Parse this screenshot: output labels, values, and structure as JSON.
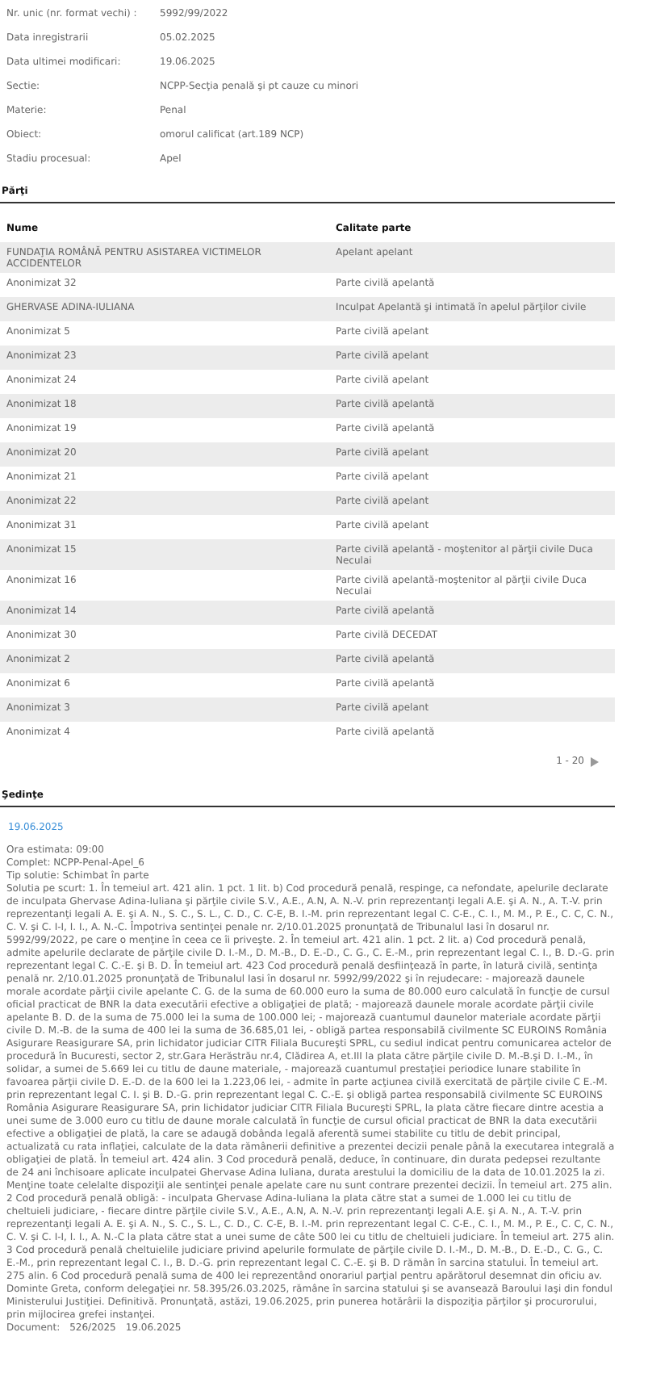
{
  "case_details": [
    {
      "label": "Nr. unic (nr. format vechi) :",
      "value": "5992/99/2022"
    },
    {
      "label": "Data inregistrarii",
      "value": "05.02.2025"
    },
    {
      "label": "Data ultimei modificari:",
      "value": "19.06.2025"
    },
    {
      "label": "Sectie:",
      "value": "NCPP-Secţia penală şi pt cauze cu minori"
    },
    {
      "label": "Materie:",
      "value": "Penal"
    },
    {
      "label": "Obiect:",
      "value": "omorul calificat (art.189 NCP)"
    },
    {
      "label": "Stadiu procesual:",
      "value": "Apel"
    }
  ],
  "parties": {
    "heading": "Părţi",
    "columns": [
      "Nume",
      "Calitate parte"
    ],
    "rows": [
      {
        "name": "FUNDAŢIA ROMÂNĂ PENTRU ASISTAREA VICTIMELOR ACCIDENTELOR",
        "role": "Apelant apelant"
      },
      {
        "name": "Anonimizat 32",
        "role": "Parte civilă apelantă"
      },
      {
        "name": "GHERVASE ADINA-IULIANA",
        "role": "Inculpat Apelantă şi intimată în apelul părţilor civile"
      },
      {
        "name": "Anonimizat 5",
        "role": "Parte civilă apelant"
      },
      {
        "name": "Anonimizat 23",
        "role": "Parte civilă apelant"
      },
      {
        "name": "Anonimizat 24",
        "role": "Parte civilă apelant"
      },
      {
        "name": "Anonimizat 18",
        "role": "Parte civilă apelantă"
      },
      {
        "name": "Anonimizat 19",
        "role": "Parte civilă apelantă"
      },
      {
        "name": "Anonimizat 20",
        "role": "Parte civilă apelant"
      },
      {
        "name": "Anonimizat 21",
        "role": "Parte civilă apelant"
      },
      {
        "name": "Anonimizat 22",
        "role": "Parte civilă apelant"
      },
      {
        "name": "Anonimizat 31",
        "role": "Parte civilă apelant"
      },
      {
        "name": "Anonimizat 15",
        "role": "Parte civilă apelantă - moştenitor al părţii civile Duca Neculai"
      },
      {
        "name": "Anonimizat 16",
        "role": "Parte civilă apelantă-moştenitor al părţii civile Duca Neculai"
      },
      {
        "name": "Anonimizat 14",
        "role": "Parte civilă apelantă"
      },
      {
        "name": "Anonimizat 30",
        "role": "Parte civilă DECEDAT"
      },
      {
        "name": "Anonimizat 2",
        "role": "Parte civilă apelantă"
      },
      {
        "name": "Anonimizat 6",
        "role": "Parte civilă apelantă"
      },
      {
        "name": "Anonimizat 3",
        "role": "Parte civilă apelant"
      },
      {
        "name": "Anonimizat 4",
        "role": "Parte civilă apelantă"
      }
    ],
    "pagination": "1 - 20"
  },
  "hearings": {
    "heading": "Şedinţe",
    "items": [
      {
        "date": "19.06.2025",
        "lines": [
          "Ora estimata: 09:00",
          "Complet: NCPP-Penal-Apel_6",
          "Tip solutie: Schimbat în parte",
          "Solutia pe scurt: 1. În temeiul art. 421 alin. 1 pct. 1 lit. b) Cod procedură penală, respinge, ca nefondate, apelurile declarate de inculpata Ghervase Adina-Iuliana şi părţile civile S.V., A.E., A.N, A. N.-V. prin reprezentanţi legali A.E. şi A. N., A. T.-V. prin reprezentanţi legali A. E. şi A. N., S. C., S. L., C. D., C. C-E, B. I.-M. prin reprezentant legal C. C-E., C. I., M. M., P. E., C. C, C. N., C. V. şi C. I-I, I. I., A. N.-C. Împotriva sentinţei penale nr. 2/10.01.2025 pronunţată de Tribunalul Iasi în dosarul nr. 5992/99/2022, pe care o menţine în ceea ce îi priveşte. 2. În temeiul art. 421 alin. 1 pct. 2 lit. a) Cod procedură penală, admite apelurile declarate de părţile civile D. I.-M., D. M.-B., D. E.-D., C. G., C. E.-M., prin reprezentant legal C. I., B. D.-G. prin reprezentant legal C. C.-E. şi B. D. În temeiul art. 423 Cod procedură penală desfiinţează în parte, în latură civilă, sentinţa penală nr. 2/10.01.2025 pronunţată de Tribunalul Iasi în dosarul nr. 5992/99/2022 şi în rejudecare: - majorează daunele morale acordate părţii civile apelante C. G. de la suma de 60.000 euro la suma de 80.000 euro calculată în funcţie de cursul oficial practicat de BNR la data executării efective a obligaţiei de plată; - majorează daunele morale acordate părţii civile apelante B. D. de la suma de 75.000 lei la suma de 100.000 lei; - majorează cuantumul daunelor materiale acordate părţii civile D. M.-B. de la suma de 400 lei la suma de 36.685,01 lei, - obligă partea responsabilă civilmente SC EUROINS România Asigurare Reasigurare SA, prin lichidator judiciar CITR Filiala Bucureşti SPRL, cu sediul indicat pentru comunicarea actelor de procedură în Bucuresti, sector 2, str.Gara Herăstrău nr.4, Clădirea A, et.III la plata către părţile civile D. M.-B.şi D. I.-M., în solidar, a sumei de 5.669 lei cu titlu de daune materiale, - majorează cuantumul prestaţiei periodice lunare stabilite în favoarea părţii civile D. E.-D. de la 600 lei la 1.223,06 lei, - admite în parte acţiunea civilă exercitată de părţile civile C E.-M. prin reprezentant legal C. I. şi B. D.-G. prin reprezentant legal C. C.-E. şi obligă partea responsabilă civilmente SC EUROINS România Asigurare Reasigurare SA, prin lichidator judiciar CITR Filiala Bucureşti SPRL, la plata către fiecare dintre acestia a unei sume de 3.000 euro cu titlu de daune morale calculată în funcţie de cursul oficial practicat de BNR la data executării efective a obligaţiei de plată, la care se adaugă dobânda legală aferentă sumei stabilite cu titlu de debit principal, actualizată cu rata inflaţiei, calculate de la data rămânerii definitive a prezentei decizii penale până la executarea integrală a obligaţiei de plată. În temeiul art. 424 alin. 3 Cod procedură penală, deduce, în continuare, din durata pedepsei rezultante de 24 ani închisoare aplicate inculpatei Ghervase Adina Iuliana, durata arestului la domiciliu de la data de 10.01.2025 la zi. Menţine toate celelalte dispoziţii ale sentinţei penale apelate care nu sunt contrare prezentei decizii. În temeiul art. 275 alin. 2 Cod procedură penală obligă: - inculpata Ghervase Adina-Iuliana la plata către stat a sumei de 1.000 lei cu titlu de cheltuieli judiciare, - fiecare dintre părţile civile S.V., A.E., A.N, A. N.-V. prin reprezentanţi legali A.E. şi A. N., A. T.-V. prin reprezentanţi legali A. E. şi A. N., S. C., S. L., C. D., C. C-E, B. I.-M. prin reprezentant legal C. C-E., C. I., M. M., P. E., C. C, C. N., C. V. şi C. I-I, I. I., A. N.-C la plata către stat a unei sume de câte 500 lei cu titlu de cheltuieli judiciare. În temeiul art. 275 alin. 3 Cod procedură penală cheltuielile judiciare privind apelurile formulate de părţile civile D. I.-M., D. M.-B., D. E.-D., C. G., C. E.-M., prin reprezentant legal C. I., B. D.-G. prin reprezentant legal C. C.-E. şi B. D rămân în sarcina statului. În temeiul art. 275 alin. 6 Cod procedură penală suma de 400 lei reprezentând onorariul parţial pentru apărătorul desemnat din oficiu av. Dominte Greta, conform delegaţiei nr. 58.395/26.03.2025, rămâne în sarcina statului şi se avansează Baroului Iaşi din fondul Ministerului Justiţiei. Definitivă. Pronunţată, astăzi, 19.06.2025, prin punerea hotărârii la dispoziţia părţilor şi procurorului, prin mijlocirea grefei instanţei."
        ],
        "document": {
          "label": "Document:",
          "number": "526/2025",
          "date": "19.06.2025"
        }
      }
    ]
  }
}
